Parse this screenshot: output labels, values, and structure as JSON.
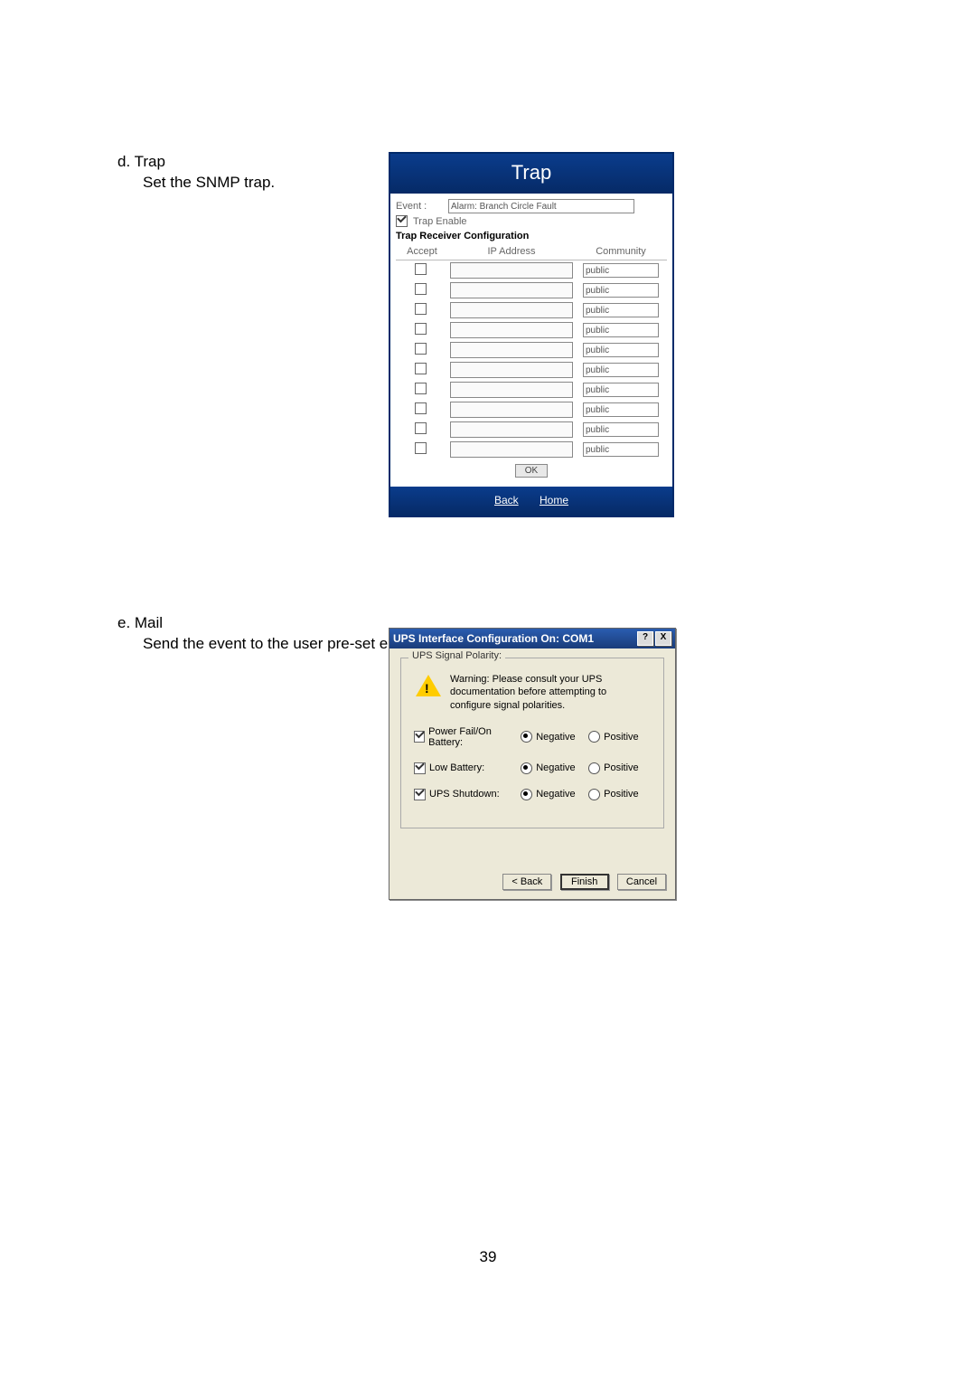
{
  "sectionD": {
    "title": "d. Trap",
    "desc": "Set the SNMP trap."
  },
  "sectionE": {
    "title": "e. Mail",
    "desc": "Send the event to the user pre-set email account."
  },
  "trap": {
    "title": "Trap",
    "eventLabel": "Event :",
    "eventValue": "Alarm: Branch Circle Fault",
    "trapEnable": "Trap Enable",
    "configHeader": "Trap Receiver Configuration",
    "cols": {
      "accept": "Accept",
      "ip": "IP Address",
      "community": "Community"
    },
    "rows": [
      {
        "community": "public"
      },
      {
        "community": "public"
      },
      {
        "community": "public"
      },
      {
        "community": "public"
      },
      {
        "community": "public"
      },
      {
        "community": "public"
      },
      {
        "community": "public"
      },
      {
        "community": "public"
      },
      {
        "community": "public"
      },
      {
        "community": "public"
      }
    ],
    "ok": "OK",
    "back": "Back",
    "home": "Home"
  },
  "ups": {
    "title": "UPS Interface Configuration On: COM1",
    "helpGlyph": "?",
    "closeGlyph": "X",
    "group": "UPS Signal Polarity:",
    "warning": "Warning: Please consult your UPS documentation before attempting to configure signal polarities.",
    "signals": [
      {
        "name": "Power Fail/On Battery:",
        "neg": "Negative",
        "pos": "Positive"
      },
      {
        "name": "Low Battery:",
        "neg": "Negative",
        "pos": "Positive"
      },
      {
        "name": "UPS Shutdown:",
        "neg": "Negative",
        "pos": "Positive"
      }
    ],
    "back": "< Back",
    "finish": "Finish",
    "cancel": "Cancel"
  },
  "pageNumber": "39"
}
